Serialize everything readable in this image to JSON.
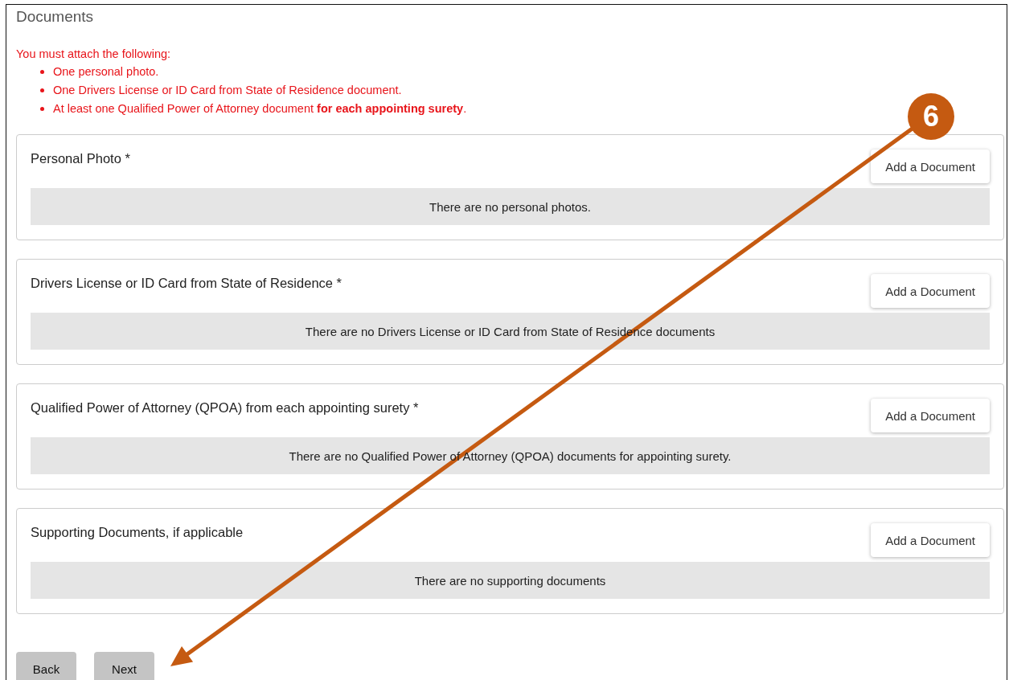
{
  "header": {
    "title": "Documents"
  },
  "requirements": {
    "intro": "You must attach the following:",
    "items": [
      "One personal photo.",
      "One Drivers License or ID Card from State of Residence document.",
      "At least one Qualified Power of Attorney document **for each appointing surety**."
    ]
  },
  "sections": [
    {
      "title": "Personal Photo *",
      "button": "Add a Document",
      "empty_message": "There are no personal photos."
    },
    {
      "title": "Drivers License or ID Card from State of Residence *",
      "button": "Add a Document",
      "empty_message": "There are no Drivers License or ID Card from State of Residence documents"
    },
    {
      "title": "Qualified Power of Attorney (QPOA) from each appointing surety *",
      "button": "Add a Document",
      "empty_message": "There are no Qualified Power of Attorney (QPOA) documents for appointing surety."
    },
    {
      "title": "Supporting Documents, if applicable",
      "button": "Add a Document",
      "empty_message": "There are no supporting documents"
    }
  ],
  "nav_buttons": [
    "Back",
    "Next"
  ],
  "annotation": {
    "badge": "6"
  }
}
